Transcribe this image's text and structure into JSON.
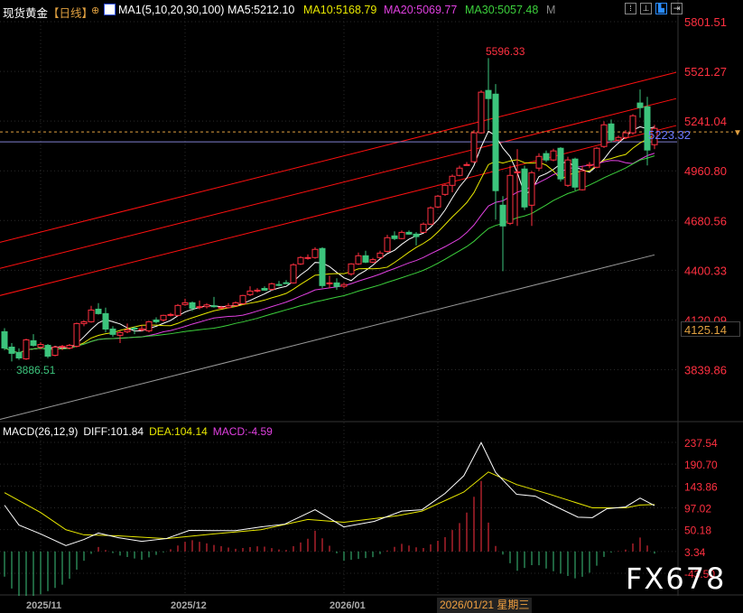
{
  "header": {
    "symbol": "现货黄金",
    "period": "【日线】",
    "ma_label": "MA1(5,10,20,30,100)",
    "ma5": "MA5:5212.10",
    "ma10": "MA10:5168.79",
    "ma20": "MA20:5069.77",
    "ma30": "MA30:5057.48",
    "more": "M",
    "tool_icons": [
      "grid-icon",
      "fit-range-icon",
      "bar-mode-icon",
      "exit-icon"
    ]
  },
  "colors": {
    "up": "#ff3040",
    "down": "#3cc47c",
    "ma5": "#ffffff",
    "ma10": "#e8e800",
    "ma20": "#e040e0",
    "ma30": "#3cd03c",
    "ma100": "#9a9a9a",
    "axis_text": "#ff3040",
    "trend": "#ff1010",
    "diff": "#ffffff",
    "dea": "#e8e800"
  },
  "cursor_price": "4125.14",
  "crosshair_price_label": "5223.32",
  "watermark": "FX678",
  "chart_data": [
    {
      "type": "candlestick",
      "y_ticks": [
        "5801.51",
        "5521.27",
        "5241.04",
        "4960.80",
        "4680.56",
        "4400.33",
        "4120.09",
        "3839.86"
      ],
      "ylim": [
        3839.86,
        5801.51
      ],
      "max_label": "5596.33",
      "min_label": "3886.51",
      "x_ticks": [
        {
          "label": "2025/11",
          "index": 5
        },
        {
          "label": "2025/12",
          "index": 25
        },
        {
          "label": "2026/01",
          "index": 47
        }
      ],
      "selected_date": {
        "label": "2026/01/21 星期三",
        "index": 60
      },
      "ohlc": [
        [
          4054,
          4074,
          3950,
          3962
        ],
        [
          3967,
          3990,
          3886.51,
          3932
        ],
        [
          3937,
          3960,
          3895,
          3906
        ],
        [
          3901,
          4015,
          3895,
          4008
        ],
        [
          4003,
          4040,
          3970,
          3977
        ],
        [
          3967,
          3995,
          3955,
          3982
        ],
        [
          3977,
          3985,
          3905,
          3916
        ],
        [
          3921,
          3975,
          3915,
          3967
        ],
        [
          3967,
          3980,
          3950,
          3972
        ],
        [
          3962,
          3985,
          3955,
          3977
        ],
        [
          3972,
          4105,
          3965,
          4100
        ],
        [
          4100,
          4118,
          4085,
          4110
        ],
        [
          4110,
          4200,
          4105,
          4176
        ],
        [
          4181,
          4215,
          4150,
          4156
        ],
        [
          4156,
          4190,
          4050,
          4069
        ],
        [
          4069,
          4085,
          4025,
          4039
        ],
        [
          4034,
          4060,
          3990,
          4049
        ],
        [
          4054,
          4100,
          4045,
          4064
        ],
        [
          4074,
          4085,
          4040,
          4070
        ],
        [
          4064,
          4090,
          4055,
          4070
        ],
        [
          4059,
          4115,
          4050,
          4110
        ],
        [
          4120,
          4135,
          4100,
          4110
        ],
        [
          4120,
          4150,
          4110,
          4146
        ],
        [
          4146,
          4160,
          4140,
          4151
        ],
        [
          4146,
          4210,
          4140,
          4202
        ],
        [
          4207,
          4240,
          4200,
          4217
        ],
        [
          4217,
          4225,
          4170,
          4186
        ],
        [
          4190,
          4230,
          4180,
          4195
        ],
        [
          4195,
          4215,
          4185,
          4205
        ],
        [
          4200,
          4250,
          4190,
          4195
        ],
        [
          4190,
          4200,
          4180,
          4192
        ],
        [
          4190,
          4215,
          4185,
          4200
        ],
        [
          4202,
          4225,
          4195,
          4217
        ],
        [
          4212,
          4262,
          4205,
          4258
        ],
        [
          4263,
          4310,
          4255,
          4283
        ],
        [
          4283,
          4300,
          4275,
          4288
        ],
        [
          4298,
          4310,
          4285,
          4288
        ],
        [
          4293,
          4330,
          4285,
          4324
        ],
        [
          4320,
          4340,
          4310,
          4319
        ],
        [
          4330,
          4345,
          4325,
          4329
        ],
        [
          4329,
          4440,
          4325,
          4431
        ],
        [
          4436,
          4480,
          4430,
          4472
        ],
        [
          4470,
          4490,
          4460,
          4472
        ],
        [
          4472,
          4530,
          4465,
          4518
        ],
        [
          4523,
          4530,
          4300,
          4314
        ],
        [
          4324,
          4370,
          4300,
          4329
        ],
        [
          4329,
          4355,
          4290,
          4309
        ],
        [
          4310,
          4330,
          4300,
          4320
        ],
        [
          4380,
          4440,
          4370,
          4436
        ],
        [
          4436,
          4500,
          4430,
          4482
        ],
        [
          4482,
          4510,
          4440,
          4446
        ],
        [
          4446,
          4470,
          4440,
          4460
        ],
        [
          4472,
          4510,
          4465,
          4497
        ],
        [
          4507,
          4600,
          4500,
          4584
        ],
        [
          4594,
          4620,
          4570,
          4579
        ],
        [
          4579,
          4625,
          4575,
          4614
        ],
        [
          4614,
          4625,
          4600,
          4604
        ],
        [
          4604,
          4615,
          4540,
          4590
        ],
        [
          4614,
          4670,
          4610,
          4660
        ],
        [
          4660,
          4760,
          4655,
          4752
        ],
        [
          4757,
          4825,
          4750,
          4818
        ],
        [
          4828,
          4885,
          4820,
          4879
        ],
        [
          4879,
          4940,
          4840,
          4930
        ],
        [
          4935,
          4990,
          4930,
          4976
        ],
        [
          4996,
          5010,
          4990,
          4996
        ],
        [
          5012,
          5190,
          5005,
          5175
        ],
        [
          5175,
          5415,
          5170,
          5404
        ],
        [
          5414,
          5596.33,
          5190,
          5368
        ],
        [
          5393,
          5450,
          4686,
          4849
        ],
        [
          4767,
          4818,
          4395,
          4650
        ],
        [
          4665,
          4990,
          4655,
          4935
        ],
        [
          4955,
          5083,
          4650,
          4955
        ],
        [
          4971,
          4990,
          4740,
          4757
        ],
        [
          4767,
          4960,
          4650,
          4950
        ],
        [
          4976,
          5060,
          4960,
          5042
        ],
        [
          5058,
          5075,
          5010,
          5022
        ],
        [
          5022,
          5085,
          5015,
          5073
        ],
        [
          5088,
          5095,
          4900,
          4915
        ],
        [
          4879,
          5040,
          4870,
          5022
        ],
        [
          5027,
          5035,
          4850,
          4869
        ],
        [
          4854,
          4990,
          4850,
          4961
        ],
        [
          4990,
          5010,
          4975,
          4996
        ],
        [
          4981,
          5095,
          4975,
          5088
        ],
        [
          5098,
          5240,
          5090,
          5220
        ],
        [
          5225,
          5250,
          5120,
          5134
        ],
        [
          5134,
          5160,
          5125,
          5149
        ],
        [
          5149,
          5190,
          5140,
          5175
        ],
        [
          5175,
          5280,
          5165,
          5271
        ],
        [
          5343,
          5419,
          5260,
          5317
        ],
        [
          5322,
          5378,
          4991,
          5078
        ],
        [
          5108,
          5220,
          5083,
          5200
        ]
      ],
      "ma100_endpoints": [
        [
          0,
          3560
        ],
        [
          90,
          4487
        ]
      ],
      "trend_lines": [
        [
          [
            0,
            4558
          ],
          [
            93,
            5516
          ]
        ],
        [
          [
            0,
            4411
          ],
          [
            93,
            5368
          ]
        ],
        [
          [
            0,
            4258
          ],
          [
            93,
            5216
          ]
        ]
      ],
      "horizontal_lines": {
        "dashed": 5180,
        "solid": 5124
      }
    },
    {
      "type": "line",
      "title": "MACD(26,12,9)",
      "diff_label": "DIFF:101.84",
      "dea_label": "DEA:104.14",
      "macd_label": "MACD:-4.59",
      "y_ticks": [
        "237.54",
        "190.70",
        "143.86",
        "97.02",
        "50.18",
        "3.34",
        "-43.50"
      ],
      "ylim": [
        -43.5,
        237.54
      ],
      "zero": 3.34,
      "diff": [
        [
          0,
          102.6
        ],
        [
          2,
          60
        ],
        [
          5,
          41
        ],
        [
          8.5,
          16
        ],
        [
          11,
          29
        ],
        [
          13,
          43
        ],
        [
          15.7,
          33
        ],
        [
          19,
          25
        ],
        [
          22.4,
          31
        ],
        [
          25.6,
          48.6
        ],
        [
          29,
          48
        ],
        [
          32,
          48
        ],
        [
          35.5,
          56
        ],
        [
          38.8,
          62
        ],
        [
          43,
          93
        ],
        [
          47,
          56
        ],
        [
          51.2,
          68
        ],
        [
          55,
          90
        ],
        [
          57.8,
          93
        ],
        [
          61,
          128
        ],
        [
          63.6,
          166
        ],
        [
          66,
          237
        ],
        [
          68,
          173
        ],
        [
          70.9,
          126
        ],
        [
          73.5,
          122
        ],
        [
          75.5,
          106
        ],
        [
          79.4,
          77
        ],
        [
          81.4,
          76
        ],
        [
          83.4,
          95
        ],
        [
          86,
          99
        ],
        [
          88,
          118
        ],
        [
          90,
          101.84
        ]
      ],
      "dea": [
        [
          0,
          129.6
        ],
        [
          5,
          87
        ],
        [
          8.5,
          50
        ],
        [
          11,
          39
        ],
        [
          15.7,
          37
        ],
        [
          22.4,
          31
        ],
        [
          29,
          41
        ],
        [
          35.5,
          50
        ],
        [
          42,
          72
        ],
        [
          47,
          66
        ],
        [
          54.4,
          80
        ],
        [
          57.8,
          90
        ],
        [
          63.6,
          131
        ],
        [
          67,
          174
        ],
        [
          70.9,
          147
        ],
        [
          75.5,
          126
        ],
        [
          81.4,
          97
        ],
        [
          86,
          97
        ],
        [
          88,
          103
        ],
        [
          90,
          104.14
        ]
      ]
    }
  ]
}
